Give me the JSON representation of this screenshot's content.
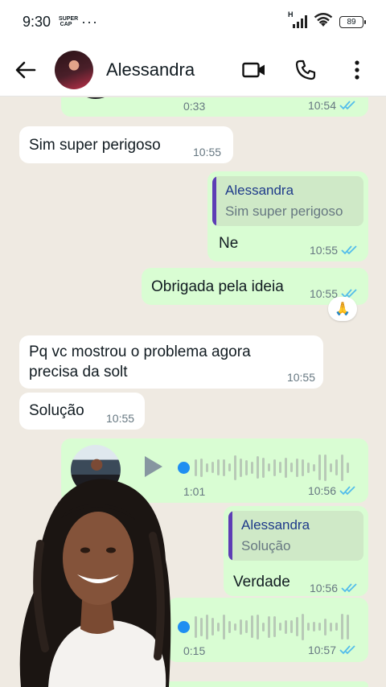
{
  "status_bar": {
    "time": "9:30",
    "supercap_line1": "SUPER",
    "supercap_line2": "CAP",
    "more": "···",
    "network": "H",
    "battery": "89"
  },
  "header": {
    "contact_name": "Alessandra",
    "icons": [
      "back-arrow-icon",
      "video-call-icon",
      "phone-icon",
      "more-vertical-icon"
    ]
  },
  "colors": {
    "incoming_bubble": "#ffffff",
    "outgoing_bubble": "#d9fdd3",
    "read_ticks": "#53bdeb",
    "chat_background": "#efeae2",
    "quote_bar": "#5d3db5"
  },
  "messages": [
    {
      "type": "voice",
      "direction": "out",
      "duration": "0:33",
      "time": "10:54",
      "status": "read"
    },
    {
      "type": "text",
      "direction": "in",
      "text": "Sim super perigoso",
      "time": "10:55"
    },
    {
      "type": "reply",
      "direction": "out",
      "quote_author": "Alessandra",
      "quote_text": "Sim super perigoso",
      "text": "Ne",
      "time": "10:55",
      "status": "read"
    },
    {
      "type": "text",
      "direction": "out",
      "text": "Obrigada pela ideia",
      "time": "10:55",
      "status": "read",
      "reaction": "🙏"
    },
    {
      "type": "text",
      "direction": "in",
      "text_line1": "Pq vc mostrou o problema agora",
      "text_line2": "precisa da solt",
      "time": "10:55"
    },
    {
      "type": "text",
      "direction": "in",
      "text": "Solução",
      "time": "10:55"
    },
    {
      "type": "voice",
      "direction": "out",
      "duration": "1:01",
      "time": "10:56",
      "status": "read"
    },
    {
      "type": "reply",
      "direction": "out",
      "quote_author": "Alessandra",
      "quote_text": "Solução",
      "text": "Verdade",
      "time": "10:56",
      "status": "read"
    },
    {
      "type": "voice",
      "direction": "out",
      "duration": "0:15",
      "time": "10:57",
      "status": "read"
    }
  ]
}
